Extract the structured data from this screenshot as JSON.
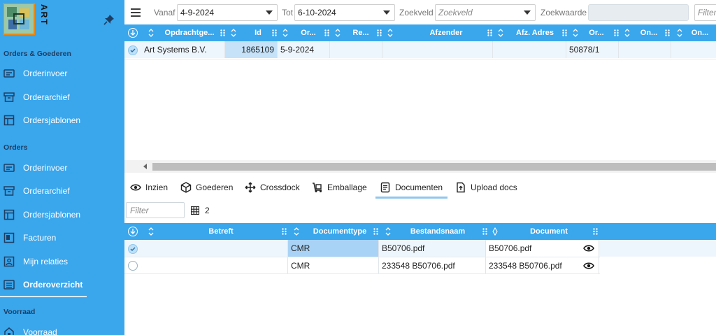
{
  "sidebar": {
    "logo_text": "ART",
    "sections": [
      {
        "title": "Orders & Goederen",
        "items": [
          {
            "label": "Orderinvoer",
            "icon": "order-entry-icon"
          },
          {
            "label": "Orderarchief",
            "icon": "archive-box-icon"
          },
          {
            "label": "Ordersjablonen",
            "icon": "template-icon"
          }
        ]
      },
      {
        "title": "Orders",
        "items": [
          {
            "label": "Orderinvoer",
            "icon": "order-entry-icon"
          },
          {
            "label": "Orderarchief",
            "icon": "archive-box-icon"
          },
          {
            "label": "Ordersjablonen",
            "icon": "template-icon"
          },
          {
            "label": "Facturen",
            "icon": "invoice-icon"
          },
          {
            "label": "Mijn relaties",
            "icon": "contacts-icon"
          },
          {
            "label": "Orderoverzicht",
            "icon": "list-icon"
          }
        ]
      },
      {
        "title": "Voorraad",
        "items": [
          {
            "label": "Voorraad",
            "icon": "stock-icon"
          }
        ]
      }
    ]
  },
  "topbar": {
    "vanaf_label": "Vanaf",
    "vanaf_value": "4-9-2024",
    "tot_label": "Tot",
    "tot_value": "6-10-2024",
    "zoekveld_label": "Zoekveld",
    "zoekveld_placeholder": "Zoekveld",
    "zoekwaarde_label": "Zoekwaarde",
    "filter_placeholder": "Filter"
  },
  "orders_grid": {
    "columns": [
      "Opdrachtge...",
      "Id",
      "Or...",
      "Re...",
      "Afzender",
      "Afz. Adres",
      "Or...",
      "On...",
      "On..."
    ],
    "rows": [
      {
        "opdrachtgever": "Art Systems B.V.",
        "id": "1865109",
        "date": "5-9-2024",
        "ref": "",
        "afzender": "",
        "afz_adres": "",
        "order": "50878/1",
        "on1": "",
        "on2": ""
      }
    ]
  },
  "tabs": [
    "Inzien",
    "Goederen",
    "Crossdock",
    "Emballage",
    "Documenten",
    "Upload docs"
  ],
  "active_tab": "Documenten",
  "docs": {
    "filter_placeholder": "Filter",
    "count": "2",
    "columns": [
      "Betreft",
      "Documenttype",
      "Bestandsnaam",
      "Document"
    ],
    "rows": [
      {
        "betreft": "",
        "type": "CMR",
        "bestandsnaam": "B50706.pdf",
        "document": "B50706.pdf"
      },
      {
        "betreft": "",
        "type": "CMR",
        "bestandsnaam": "233548 B50706.pdf",
        "document": "233548 B50706.pdf"
      }
    ]
  },
  "colors": {
    "accent": "#3aa6ec",
    "section_title": "#1d3e63"
  }
}
